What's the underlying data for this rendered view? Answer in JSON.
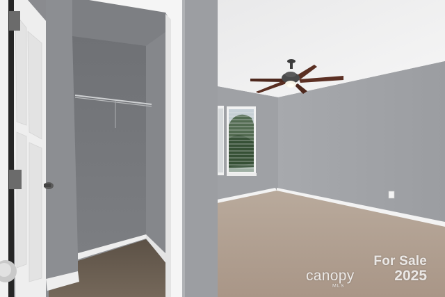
{
  "scene": {
    "description_colors": {
      "wall": "#9a9ca0",
      "ceiling": "#f1f1f1",
      "carpet": "#b3a396",
      "trim": "#f4f4f4",
      "closet_floor": "#6f6355",
      "fan_blade": "#5a2f22"
    }
  },
  "watermark": {
    "line1": "For Sale",
    "brand": "canopy",
    "sub": "MLS",
    "year": "2025"
  }
}
